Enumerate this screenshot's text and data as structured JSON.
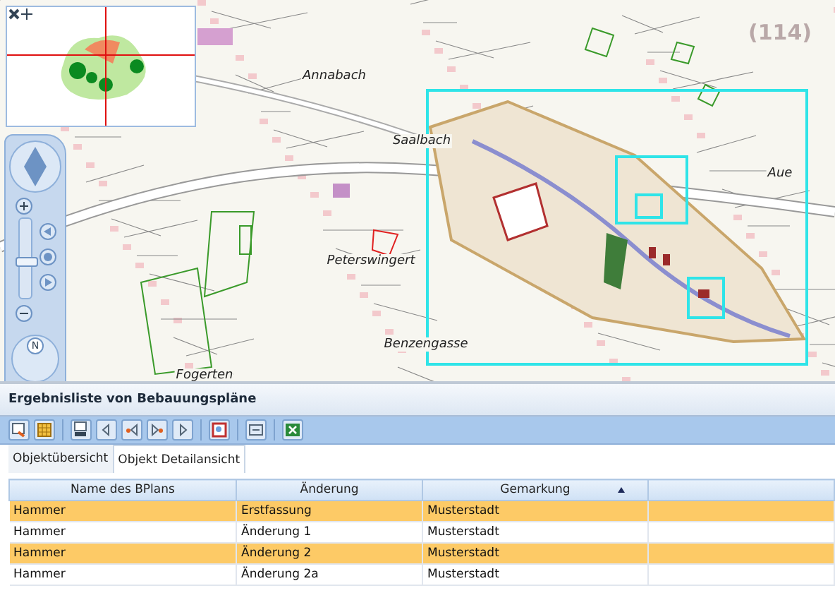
{
  "map": {
    "labels": [
      {
        "text": "Annabach"
      },
      {
        "text": "Saalbach"
      },
      {
        "text": "Peterswingert"
      },
      {
        "text": "Benzengasse"
      },
      {
        "text": "Aue"
      },
      {
        "text": "(114)"
      },
      {
        "text": "Fogerten"
      }
    ],
    "navigation": {
      "zoom_slider": {
        "level": 0.47
      },
      "compass": "N"
    }
  },
  "panel": {
    "title": "Ergebnisliste von Bebauungspläne",
    "tabs": [
      {
        "label": "Objektübersicht",
        "selected": false
      },
      {
        "label": "Objekt Detailansicht",
        "selected": true
      }
    ],
    "table": {
      "columns": [
        "Name des BPlans",
        "Änderung",
        "Gemarkung"
      ],
      "rows": [
        {
          "cells": [
            "Hammer",
            "Erstfassung",
            "Musterstadt"
          ],
          "selected": true
        },
        {
          "cells": [
            "Hammer",
            "Änderung 1",
            "Musterstadt"
          ],
          "selected": false
        },
        {
          "cells": [
            "Hammer",
            "Änderung 2",
            "Musterstadt"
          ],
          "selected": true
        },
        {
          "cells": [
            "Hammer",
            "Änderung 2a",
            "Musterstadt"
          ],
          "selected": false
        }
      ]
    }
  }
}
